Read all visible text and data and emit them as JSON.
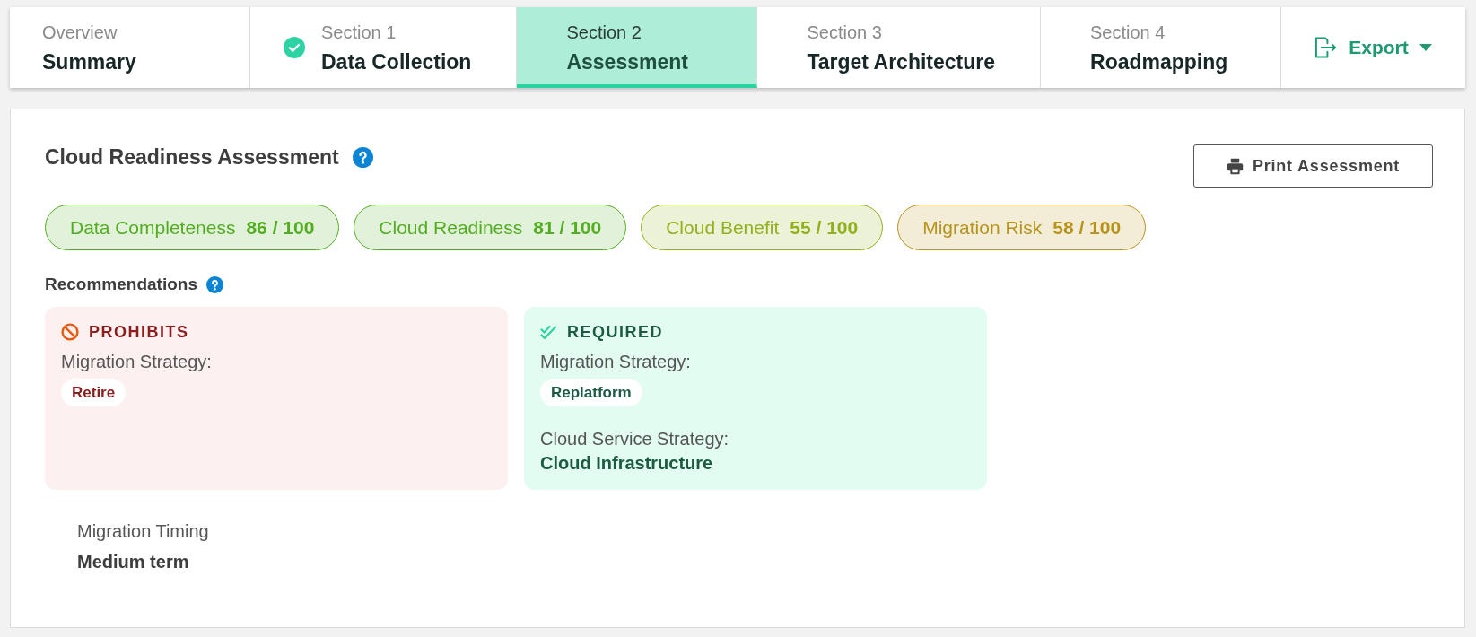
{
  "tabs": [
    {
      "eyebrow": "Overview",
      "label": "Summary",
      "selected": false,
      "completed": false
    },
    {
      "eyebrow": "Section 1",
      "label": "Data Collection",
      "selected": false,
      "completed": true
    },
    {
      "eyebrow": "Section 2",
      "label": "Assessment",
      "selected": true,
      "completed": false
    },
    {
      "eyebrow": "Section 3",
      "label": "Target Architecture",
      "selected": false,
      "completed": false
    },
    {
      "eyebrow": "Section 4",
      "label": "Roadmapping",
      "selected": false,
      "completed": false
    }
  ],
  "export_menu": {
    "label": "Export"
  },
  "assessment": {
    "title": "Cloud Readiness Assessment",
    "print_button": "Print Assessment",
    "scores": [
      {
        "label": "Data Completeness",
        "value": "86 / 100",
        "color": "#52ad22"
      },
      {
        "label": "Cloud Readiness",
        "value": "81 / 100",
        "color": "#52ad22"
      },
      {
        "label": "Cloud Benefit",
        "value": "55 / 100",
        "color": "#92b01a"
      },
      {
        "label": "Migration Risk",
        "value": "58 / 100",
        "color": "#b8931c"
      }
    ],
    "recommendations": {
      "title": "Recommendations",
      "groups": [
        {
          "kind": "prohibits",
          "heading": "PROHIBITS",
          "fields": [
            {
              "kind": "chip",
              "label": "Migration Strategy:",
              "value": "Retire"
            }
          ]
        },
        {
          "kind": "required",
          "heading": "REQUIRED",
          "fields": [
            {
              "kind": "chip",
              "label": "Migration Strategy:",
              "value": "Replatform"
            },
            {
              "kind": "text",
              "label": "Cloud Service Strategy:",
              "value": "Cloud Infrastructure"
            }
          ]
        }
      ]
    },
    "timing": {
      "label": "Migration Timing",
      "value": "Medium term"
    }
  }
}
